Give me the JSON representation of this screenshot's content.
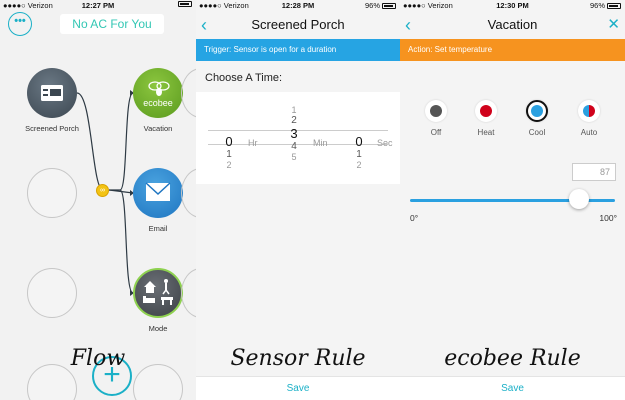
{
  "panels": [
    {
      "status": {
        "carrier": "●●●●○ Verizon",
        "time": "12:27 PM",
        "battery": ""
      },
      "title": "No AC For You",
      "nodes": [
        {
          "label": "Screened Porch"
        },
        {
          "label": "Vacation",
          "icon_text": "ecobee"
        },
        {
          "label": "Email"
        },
        {
          "label": "Mode"
        }
      ],
      "caption": "Flow"
    },
    {
      "status": {
        "carrier": "●●●●○ Verizon",
        "time": "12:28 PM",
        "battery": "96%"
      },
      "title": "Screened Porch",
      "banner": "Trigger: Sensor is open for a duration",
      "choose_label": "Choose A Time:",
      "picker": {
        "hr": {
          "above": "",
          "selected": "0",
          "below1": "1",
          "below2": "2",
          "unit": "Hr"
        },
        "min": {
          "above2": "1",
          "above1": "2",
          "selected": "3",
          "below1": "4",
          "below2": "5",
          "unit": "Min"
        },
        "sec": {
          "selected": "0",
          "below1": "1",
          "below2": "2",
          "unit": "Sec"
        }
      },
      "save_label": "Save",
      "caption": "Sensor Rule"
    },
    {
      "status": {
        "carrier": "●●●●○ Verizon",
        "time": "12:30 PM",
        "battery": "96%"
      },
      "title": "Vacation",
      "banner": "Action: Set temperature",
      "modes": [
        {
          "label": "Off",
          "color": "#555555",
          "active": false
        },
        {
          "label": "Heat",
          "color": "#d0021b",
          "active": false
        },
        {
          "label": "Cool",
          "color": "#2aa0e0",
          "active": true
        },
        {
          "label": "Auto",
          "color": "#d0021b",
          "active": false
        }
      ],
      "temperature": "87",
      "slider_min": "0°",
      "slider_max": "100°",
      "slider_value": 87,
      "save_label": "Save",
      "caption": "ecobee Rule"
    }
  ],
  "colors": {
    "accent": "#1bb0c7",
    "trigger_banner": "#26a4e3",
    "action_banner": "#f6931f",
    "flow_line": "#2e3a44"
  }
}
